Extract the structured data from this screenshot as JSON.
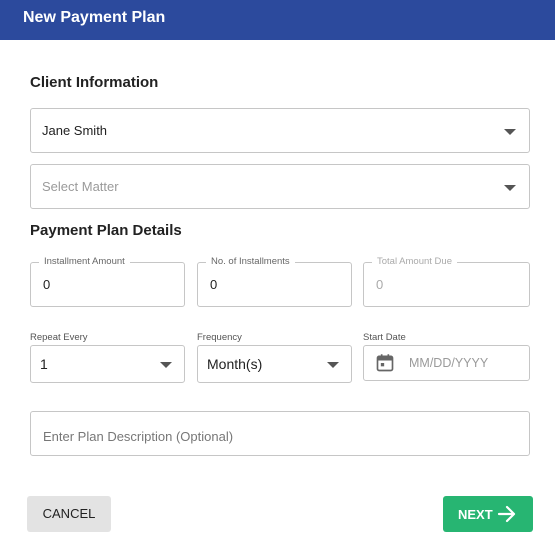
{
  "header": {
    "title": "New Payment Plan"
  },
  "client_section": {
    "title": "Client Information",
    "client_select": {
      "value": "Jane Smith"
    },
    "matter_select": {
      "placeholder": "Select Matter"
    }
  },
  "details_section": {
    "title": "Payment Plan Details",
    "installment_amount": {
      "label": "Installment Amount",
      "value": "0"
    },
    "installments_count": {
      "label": "No. of Installments",
      "value": "0"
    },
    "total_amount_due": {
      "label": "Total Amount Due",
      "value": "0"
    },
    "repeat_every": {
      "label": "Repeat Every",
      "value": "1"
    },
    "frequency": {
      "label": "Frequency",
      "value": "Month(s)"
    },
    "start_date": {
      "label": "Start Date",
      "placeholder": "MM/DD/YYYY"
    },
    "description": {
      "placeholder": "Enter Plan Description (Optional)"
    }
  },
  "actions": {
    "cancel_label": "CANCEL",
    "next_label": "NEXT"
  },
  "colors": {
    "header_bg": "#2c4a9d",
    "next_bg": "#27b572",
    "cancel_bg": "#e3e3e3"
  },
  "icons": {
    "dropdown": "caret-down-icon",
    "calendar": "calendar-icon",
    "next": "arrow-right-icon"
  }
}
